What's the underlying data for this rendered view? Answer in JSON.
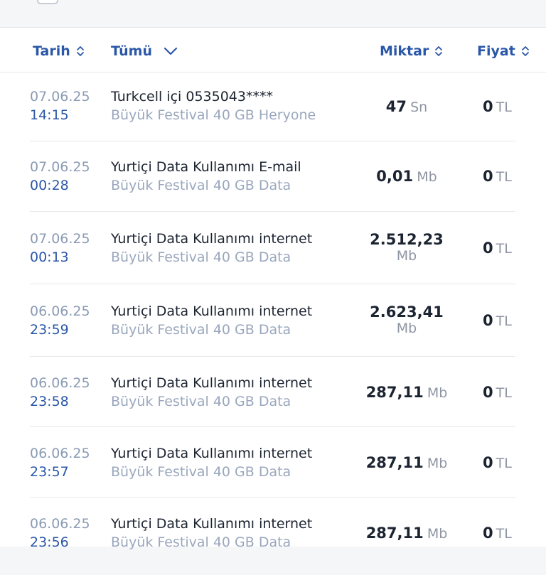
{
  "header": {
    "date_label": "Tarih",
    "all_label": "Tümü",
    "amount_label": "Miktar",
    "price_label": "Fiyat"
  },
  "rows": [
    {
      "date": "07.06.25",
      "time": "14:15",
      "title": "Turkcell içi 0535043****",
      "sub": "Büyük Festival 40 GB Heryone",
      "amount": "47",
      "amount_unit": "Sn",
      "price": "0",
      "price_unit": "TL"
    },
    {
      "date": "07.06.25",
      "time": "00:28",
      "title": "Yurtiçi Data Kullanımı E-mail",
      "sub": "Büyük Festival 40 GB Data",
      "amount": "0,01",
      "amount_unit": "Mb",
      "price": "0",
      "price_unit": "TL"
    },
    {
      "date": "07.06.25",
      "time": "00:13",
      "title": "Yurtiçi Data Kullanımı internet",
      "sub": "Büyük Festival 40 GB Data",
      "amount": "2.512,23",
      "amount_unit": "Mb",
      "price": "0",
      "price_unit": "TL"
    },
    {
      "date": "06.06.25",
      "time": "23:59",
      "title": "Yurtiçi Data Kullanımı internet",
      "sub": "Büyük Festival 40 GB Data",
      "amount": "2.623,41",
      "amount_unit": "Mb",
      "price": "0",
      "price_unit": "TL"
    },
    {
      "date": "06.06.25",
      "time": "23:58",
      "title": "Yurtiçi Data Kullanımı internet",
      "sub": "Büyük Festival 40 GB Data",
      "amount": "287,11",
      "amount_unit": "Mb",
      "price": "0",
      "price_unit": "TL"
    },
    {
      "date": "06.06.25",
      "time": "23:57",
      "title": "Yurtiçi Data Kullanımı internet",
      "sub": "Büyük Festival 40 GB Data",
      "amount": "287,11",
      "amount_unit": "Mb",
      "price": "0",
      "price_unit": "TL"
    },
    {
      "date": "06.06.25",
      "time": "23:56",
      "title": "Yurtiçi Data Kullanımı internet",
      "sub": "Büyük Festival 40 GB Data",
      "amount": "287,11",
      "amount_unit": "Mb",
      "price": "0",
      "price_unit": "TL"
    }
  ]
}
